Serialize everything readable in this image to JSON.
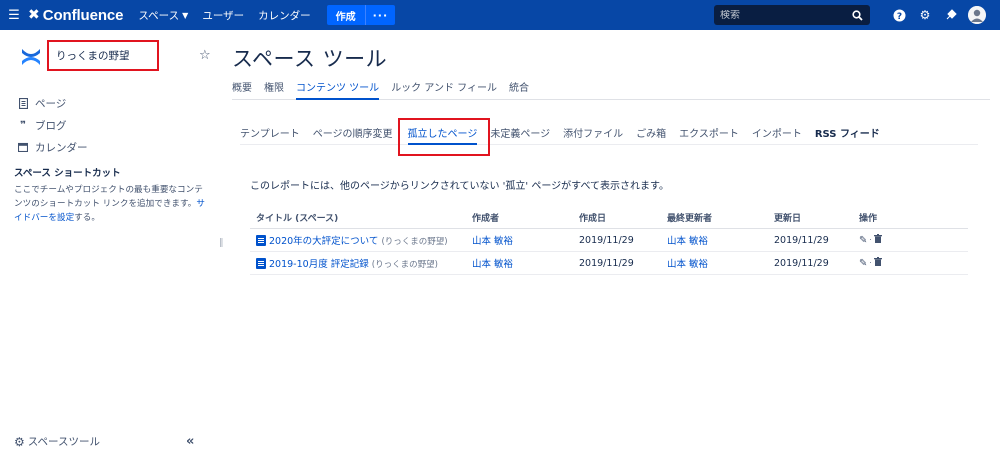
{
  "topbar": {
    "menu_icon": "menu-icon",
    "logo_text": "Confluence",
    "nav": [
      {
        "label": "スペース",
        "has_caret": true
      },
      {
        "label": "ユーザー"
      },
      {
        "label": "カレンダー"
      }
    ],
    "create_label": "作成",
    "create_more": "···",
    "search_placeholder": "検索",
    "icons": [
      "help-icon",
      "settings-icon",
      "notifications-icon",
      "avatar"
    ]
  },
  "sidebar": {
    "space_name": "りっくまの野望",
    "links": [
      {
        "icon": "page-icon",
        "label": "ページ"
      },
      {
        "icon": "blog-icon",
        "label": "ブログ"
      },
      {
        "icon": "calendar-icon",
        "label": "カレンダー"
      }
    ],
    "shortcut_title": "スペース ショートカット",
    "shortcut_desc": "ここでチームやプロジェクトの最も重要なコンテンツのショートカット リンクを追加できます。",
    "shortcut_link": "サイドバーを設定",
    "shortcut_suffix": "する。",
    "tools_label": "スペースツール"
  },
  "main": {
    "title": "スペース ツール",
    "tabs": [
      {
        "label": "概要"
      },
      {
        "label": "権限"
      },
      {
        "label": "コンテンツ ツール",
        "active": true
      },
      {
        "label": "ルック アンド フィール"
      },
      {
        "label": "統合"
      }
    ],
    "subtabs": [
      {
        "label": "テンプレート"
      },
      {
        "label": "ページの順序変更"
      },
      {
        "label": "孤立したページ",
        "active": true
      },
      {
        "label": "未定義ページ"
      },
      {
        "label": "添付ファイル"
      },
      {
        "label": "ごみ箱"
      },
      {
        "label": "エクスポート"
      },
      {
        "label": "インポート"
      },
      {
        "label": "RSS フィード"
      }
    ],
    "report_desc": "このレポートには、他のページからリンクされていない '孤立' ページがすべて表示されます。",
    "table": {
      "headers": [
        "タイトル (スペース)",
        "作成者",
        "作成日",
        "最終更新者",
        "更新日",
        "操作"
      ],
      "rows": [
        {
          "title": "2020年の大評定について",
          "space": "(りっくまの野望)",
          "creator": "山本 敏裕",
          "created": "2019/11/29",
          "modifier": "山本 敏裕",
          "modified": "2019/11/29"
        },
        {
          "title": "2019-10月度 評定記録",
          "space": "(りっくまの野望)",
          "creator": "山本 敏裕",
          "created": "2019/11/29",
          "modifier": "山本 敏裕",
          "modified": "2019/11/29"
        }
      ]
    }
  },
  "colors": {
    "topbar": "#0747a6",
    "link": "#0052cc",
    "highlight": "#e1141f"
  }
}
